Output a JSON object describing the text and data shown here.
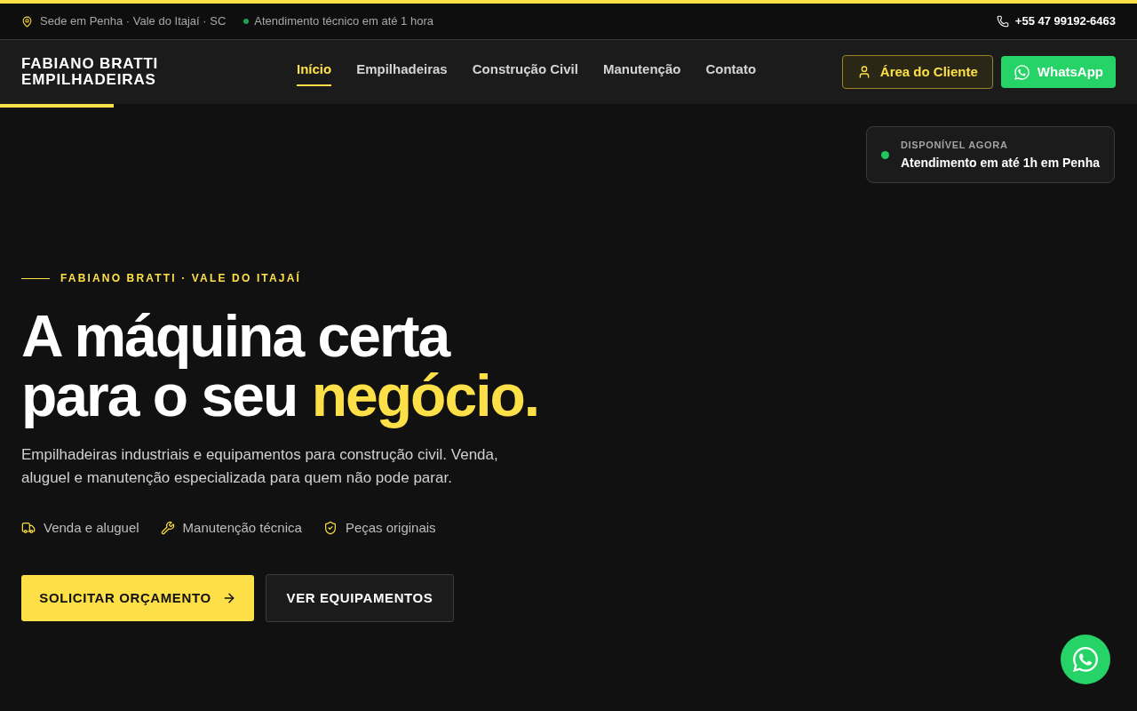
{
  "top_bar": {
    "location": "Sede em Penha · Vale do Itajaí · SC",
    "service_note": "Atendimento técnico em até 1 hora",
    "phone": "+55 47 99192-6463"
  },
  "header": {
    "logo": {
      "line_1": "FABIANO BRATTI",
      "line_2": "EMPILHADEIRAS"
    },
    "nav": [
      {
        "label": "Início",
        "selected": true
      },
      {
        "label": "Empilhadeiras",
        "selected": false
      },
      {
        "label": "Construção Civil",
        "selected": false
      },
      {
        "label": "Manutenção",
        "selected": false
      },
      {
        "label": "Contato",
        "selected": false
      }
    ],
    "actions": [
      {
        "kind": "client",
        "label": "Área do Cliente"
      },
      {
        "kind": "whatsapp",
        "label": "WhatsApp"
      }
    ]
  },
  "hero": {
    "status_card": {
      "caption": "DISPONÍVEL AGORA",
      "text": "Atendimento em até 1h em Penha"
    },
    "eyebrow": "FABIANO BRATTI · VALE DO ITAJAÍ",
    "headline": {
      "line_1": "A máquina certa",
      "line_2": "para o seu",
      "highlight": "negócio."
    },
    "description": "Empilhadeiras industriais e equipamentos para construção civil. Venda, aluguel e manutenção especializada para quem não pode parar.",
    "features": [
      "Venda e aluguel",
      "Manutenção técnica",
      "Peças originais"
    ],
    "buttons": [
      {
        "kind": "primary",
        "label": "SOLICITAR ORÇAMENTO"
      },
      {
        "kind": "secondary",
        "label": "VER EQUIPAMENTOS"
      }
    ]
  }
}
